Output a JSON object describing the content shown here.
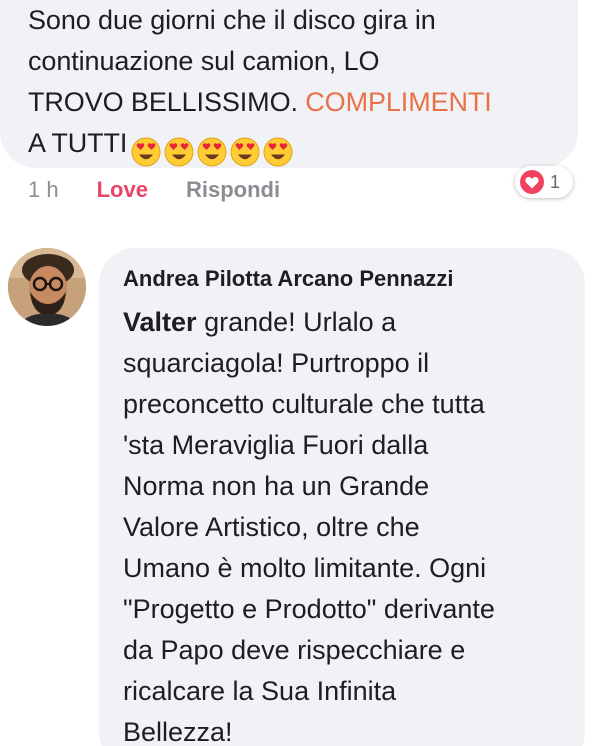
{
  "first_comment": {
    "lines": [
      "Sono due giorni che il disco gira in",
      "continuazione sul camion,  LO",
      "TROVO BELLISSIMO."
    ],
    "highlight": "COMPLIMENTI",
    "last_line": "A TUTTI",
    "emoji_names": [
      "heart-eyes-emoji",
      "heart-eyes-emoji",
      "heart-eyes-emoji",
      "heart-eyes-emoji",
      "heart-eyes-emoji"
    ]
  },
  "actions": {
    "time": "1 h",
    "love": "Love",
    "reply": "Rispondi"
  },
  "reactions": {
    "icon": "heart-icon",
    "count": "1",
    "color": "#f0415f"
  },
  "second_comment": {
    "author": "Andrea Pilotta Arcano Pennazzi",
    "mention": "Valter",
    "first_line_rest": " grande! Urlalo a",
    "lines": [
      "squarciagola! Purtroppo il",
      "preconcetto culturale che tutta",
      "'sta Meraviglia Fuori dalla",
      "Norma non ha un Grande",
      "Valore Artistico, oltre che",
      "Umano è molto limitante. Ogni",
      "\"Progetto e Prodotto\" derivante",
      "da Papo deve rispecchiare e",
      "ricalcare la Sua Infinita",
      "Bellezza!"
    ]
  },
  "colors": {
    "bubble": "#f0f2f5",
    "highlight": "#e9714a",
    "love": "#e94567",
    "text": "#1c1e21",
    "muted": "#8a8d91"
  }
}
